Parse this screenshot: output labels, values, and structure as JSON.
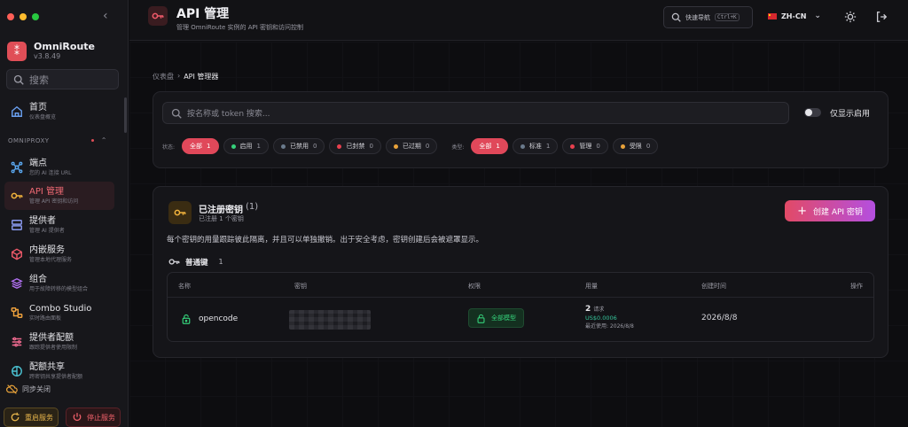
{
  "sidebar": {
    "brand_name": "OmniRoute",
    "brand_version": "v3.8.49",
    "search_placeholder": "搜索",
    "home": {
      "label": "首页",
      "desc": "仪表盘概览"
    },
    "section_title": "OMNIPROXY",
    "items": [
      {
        "label": "端点",
        "desc": "您的 AI 连接 URL",
        "icon": "endpoint-icon"
      },
      {
        "label": "API 管理",
        "desc": "管理 API 密钥和访问",
        "icon": "key-icon",
        "active": true
      },
      {
        "label": "提供者",
        "desc": "管理 AI 提供者",
        "icon": "provider-icon"
      },
      {
        "label": "内嵌服务",
        "desc": "管理本地代理服务",
        "icon": "cube-icon"
      },
      {
        "label": "组合",
        "desc": "用于故障转移的模型组合",
        "icon": "layers-icon"
      },
      {
        "label": "Combo Studio",
        "desc": "实时路由面板",
        "icon": "combo-icon"
      },
      {
        "label": "提供者配额",
        "desc": "跟踪提供者使用限制",
        "icon": "sliders-icon"
      },
      {
        "label": "配额共享",
        "desc": "跨密钥共享提供者配额",
        "icon": "share-icon"
      }
    ],
    "sync_label": "同步关闭",
    "restart_label": "重启服务",
    "stop_label": "停止服务"
  },
  "header": {
    "title": "API 管理",
    "subtitle": "管理 OmniRoute 实例的 API 密钥和访问控制",
    "quick_nav": "快速导航",
    "shortcut": "Ctrl+K",
    "language": "ZH-CN"
  },
  "breadcrumb": {
    "root": "仪表盘",
    "separator": "›",
    "current": "API 管理器"
  },
  "filters": {
    "search_placeholder": "按名称或 token 搜索...",
    "toggle_label": "仅显示启用",
    "status_label": "状态:",
    "status_chips": [
      {
        "label": "全部",
        "count": "1",
        "active": true,
        "color": ""
      },
      {
        "label": "启用",
        "count": "1",
        "color": "#35d07a"
      },
      {
        "label": "已禁用",
        "count": "0",
        "color": "#6a7a8c"
      },
      {
        "label": "已封禁",
        "count": "0",
        "color": "#e8404e"
      },
      {
        "label": "已过期",
        "count": "0",
        "color": "#e8a23a"
      }
    ],
    "type_label": "类型:",
    "type_chips": [
      {
        "label": "全部",
        "count": "1",
        "active": true,
        "color": ""
      },
      {
        "label": "标准",
        "count": "1",
        "color": "#6a7a8c"
      },
      {
        "label": "管理",
        "count": "0",
        "color": "#e8404e"
      },
      {
        "label": "受限",
        "count": "0",
        "color": "#e8a23a"
      }
    ]
  },
  "registered": {
    "title": "已注册密钥",
    "count": "(1)",
    "subtitle": "已注册 1 个密钥",
    "create_button": "创建 API 密钥",
    "description": "每个密钥的用量跟踪彼此隔离，并且可以单独撤销。出于安全考虑，密钥创建后会被遮罩显示。",
    "group_label": "普通键",
    "group_count": "1",
    "columns": [
      "名称",
      "密钥",
      "权限",
      "用量",
      "创建时间",
      "操作"
    ],
    "rows": [
      {
        "name": "opencode",
        "permission": "全部模型",
        "usage_count": "2",
        "usage_unit": "请求",
        "usage_cost": "US$0.0006",
        "last_used": "最近使用: 2026/8/8",
        "created": "2026/8/8"
      }
    ]
  },
  "colors": {
    "accent": "#e0485a",
    "success": "#35d07a",
    "warning": "#e8a23a"
  }
}
